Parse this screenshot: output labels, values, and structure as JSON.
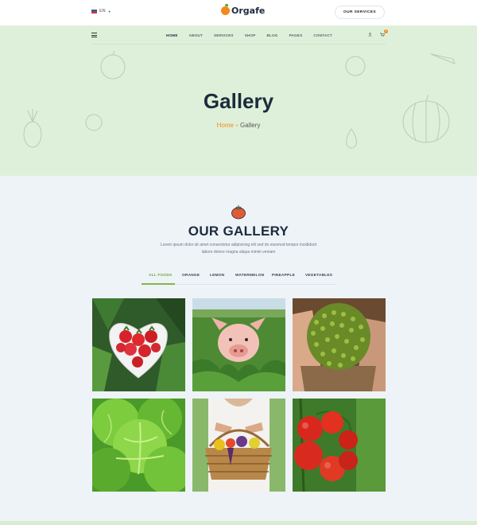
{
  "topbar": {
    "language": "EN",
    "logo_text": "Orgafe",
    "services_button": "OUR SERVICES"
  },
  "nav": {
    "items": [
      {
        "label": "HOME",
        "active": true
      },
      {
        "label": "ABOUT",
        "active": false
      },
      {
        "label": "SERVICES",
        "active": false
      },
      {
        "label": "SHOP",
        "active": false
      },
      {
        "label": "BLOG",
        "active": false
      },
      {
        "label": "PAGES",
        "active": false
      },
      {
        "label": "CONTACT",
        "active": false
      }
    ],
    "cart_count": "0"
  },
  "hero": {
    "title": "Gallery",
    "breadcrumb_home": "Home",
    "breadcrumb_current": "Gallery"
  },
  "gallery": {
    "title": "OUR GALLERY",
    "description": "Lorem ipsum dolor sit amet consectetur adipisicing elit sed do eiusmod tempor incididunt labore dolore magna aliqua minim veniam",
    "filters": [
      "ALL FOODS",
      "ORANGE",
      "LEMON",
      "WATERMELON",
      "PINEAPPLE",
      "VEGETABLES"
    ],
    "active_filter": "ALL FOODS",
    "images": [
      {
        "subject": "strawberries in heart bowl"
      },
      {
        "subject": "pig in field"
      },
      {
        "subject": "green peas in sack"
      },
      {
        "subject": "lettuce"
      },
      {
        "subject": "vegetable basket"
      },
      {
        "subject": "tomatoes on vine"
      }
    ]
  },
  "colors": {
    "accent_orange": "#f28a1a",
    "accent_green": "#7fb847",
    "hero_bg": "#dff0da",
    "page_bg": "#eef3f7",
    "heading": "#1c2b3c"
  }
}
